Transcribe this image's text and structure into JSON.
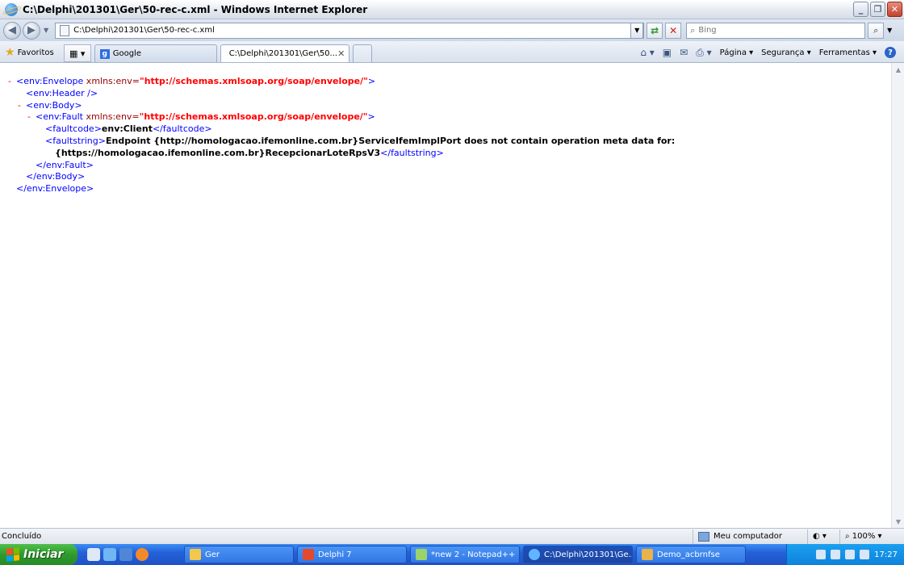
{
  "window": {
    "title": "C:\\Delphi\\201301\\Ger\\50-rec-c.xml - Windows Internet Explorer"
  },
  "address_bar": {
    "url": "C:\\Delphi\\201301\\Ger\\50-rec-c.xml",
    "search_placeholder": "Bing"
  },
  "favorites_bar": {
    "label": "Favoritos"
  },
  "tabs": [
    {
      "label": "Google"
    },
    {
      "label": "C:\\Delphi\\201301\\Ger\\50..."
    }
  ],
  "command_bar": {
    "page": "Página",
    "security": "Segurança",
    "tools": "Ferramentas"
  },
  "xml": {
    "lines": [
      {
        "marker": "-",
        "indent": 0,
        "tag_open": "<env:Envelope",
        "attr": " xmlns:env=",
        "value": "\"http://schemas.xmlsoap.org/soap/envelope/\"",
        "tag_close": ">"
      },
      {
        "marker": "",
        "indent": 1,
        "tag_open": "<env:Header",
        "attr": "",
        "value": "",
        "tag_close": " />"
      },
      {
        "marker": "-",
        "indent": 1,
        "tag_open": "<env:Body",
        "attr": "",
        "value": "",
        "tag_close": ">"
      },
      {
        "marker": "-",
        "indent": 2,
        "tag_open": "<env:Fault",
        "attr": " xmlns:env=",
        "value": "\"http://schemas.xmlsoap.org/soap/envelope/\"",
        "tag_close": ">"
      },
      {
        "marker": "",
        "indent": 3,
        "tag_open": "<faultcode>",
        "text": "env:Client",
        "tag_end": "</faultcode>"
      },
      {
        "marker": "",
        "indent": 3,
        "tag_open": "<faultstring>",
        "text": "Endpoint {http://homologacao.ifemonline.com.br}ServiceIfemImplPort does not contain operation meta data for:",
        "tag_end": ""
      },
      {
        "marker": "",
        "indent": 4,
        "tag_open": "",
        "text": "{https://homologacao.ifemonline.com.br}RecepcionarLoteRpsV3",
        "tag_end": "</faultstring>"
      },
      {
        "marker": "",
        "indent": 2,
        "tag_open": "</env:Fault>",
        "attr": "",
        "value": "",
        "tag_close": ""
      },
      {
        "marker": "",
        "indent": 1,
        "tag_open": "</env:Body>",
        "attr": "",
        "value": "",
        "tag_close": ""
      },
      {
        "marker": "",
        "indent": 0,
        "tag_open": "</env:Envelope>",
        "attr": "",
        "value": "",
        "tag_close": ""
      }
    ]
  },
  "status_bar": {
    "text": "Concluído",
    "zone": "Meu computador",
    "zoom": "100%"
  },
  "taskbar": {
    "start_label": "Iniciar",
    "tasks": [
      {
        "label": "Ger",
        "icon_color": "#f3c64d"
      },
      {
        "label": "Delphi 7",
        "icon_color": "#e24a2e"
      },
      {
        "label": "*new  2 - Notepad++",
        "icon_color": "#9bd36b"
      },
      {
        "label": "C:\\Delphi\\201301\\Ge...",
        "icon_color": "#5fb5ff"
      },
      {
        "label": "Demo_acbrnfse",
        "icon_color": "#e9b24a"
      }
    ],
    "clock": "17:27"
  }
}
